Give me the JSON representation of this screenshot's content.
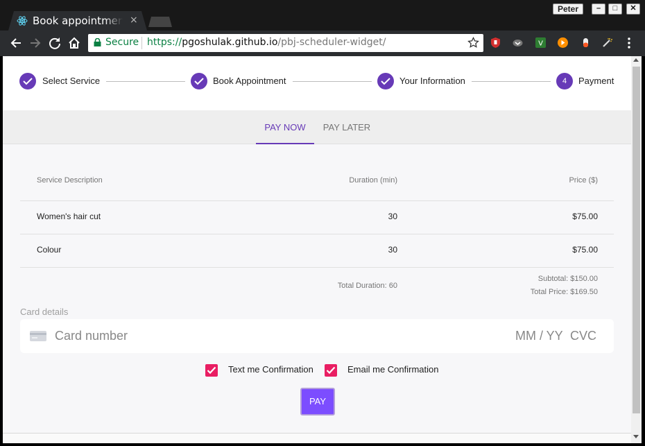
{
  "browser": {
    "tab_title": "Book appointment",
    "tab_close": "×",
    "profile_name": "Peter",
    "window_buttons": {
      "minimize": "–",
      "maximize": "□",
      "close": "✕"
    },
    "secure_label": "Secure",
    "url": {
      "scheme": "https://",
      "host": "pgoshulak.github.io",
      "path": "/pbj-scheduler-widget/"
    },
    "accent": "#0b8043"
  },
  "stepper": {
    "steps": [
      {
        "label": "Select Service",
        "state": "complete"
      },
      {
        "label": "Book Appointment",
        "state": "complete"
      },
      {
        "label": "Your Information",
        "state": "complete"
      },
      {
        "label": "Payment",
        "number": "4",
        "state": "active"
      }
    ],
    "color": "#673ab7"
  },
  "tabs": [
    {
      "label": "PAY NOW",
      "active": true
    },
    {
      "label": "PAY LATER",
      "active": false
    }
  ],
  "table": {
    "headers": {
      "description": "Service Description",
      "duration": "Duration (min)",
      "price": "Price ($)"
    },
    "rows": [
      {
        "description": "Women's hair cut",
        "duration": "30",
        "price": "$75.00"
      },
      {
        "description": "Colour",
        "duration": "30",
        "price": "$75.00"
      }
    ],
    "total_duration": "Total Duration: 60",
    "subtotal": "Subtotal: $150.00",
    "total_price": "Total Price: $169.50"
  },
  "card": {
    "label": "Card details",
    "number_placeholder": "Card number",
    "expiry_placeholder": "MM / YY",
    "cvc_placeholder": "CVC"
  },
  "confirmations": {
    "text_label": "Text me Confirmation",
    "text_checked": true,
    "email_label": "Email me Confirmation",
    "email_checked": true,
    "checkbox_color": "#e91e63"
  },
  "pay_button": "PAY"
}
